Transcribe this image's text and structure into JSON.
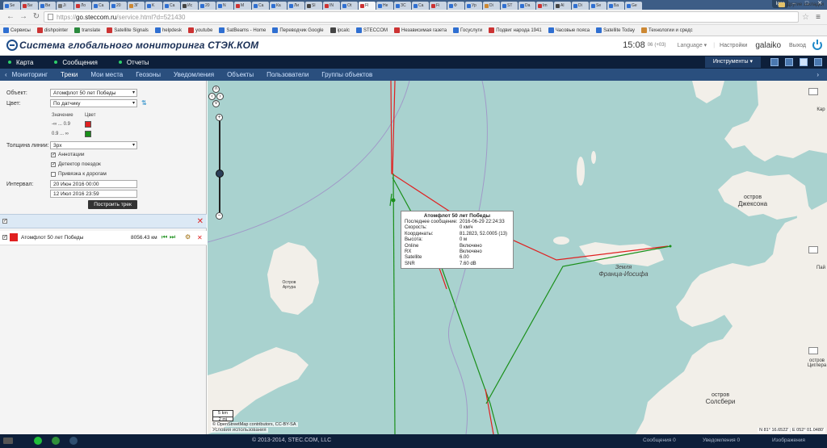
{
  "browser": {
    "user_badge": "Igor",
    "tabs": [
      {
        "label": "Se",
        "color": "#2f6fd1"
      },
      {
        "label": "Би",
        "color": "#cc3333"
      },
      {
        "label": "Ви",
        "color": "#2f6fd1"
      },
      {
        "label": "Ji",
        "color": "#777777"
      },
      {
        "label": "Ло",
        "color": "#cc3333"
      },
      {
        "label": "Ca",
        "color": "#2f6fd1"
      },
      {
        "label": "20",
        "color": "#2f6fd1"
      },
      {
        "label": "ЗГ",
        "color": "#cc8833"
      },
      {
        "label": "K",
        "color": "#2f6fd1"
      },
      {
        "label": "Ca",
        "color": "#2f6fd1"
      },
      {
        "label": "Ис",
        "color": "#444444"
      },
      {
        "label": "20",
        "color": "#2f6fd1"
      },
      {
        "label": "N",
        "color": "#2f6fd1"
      },
      {
        "label": "M",
        "color": "#cc3333"
      },
      {
        "label": "Ca",
        "color": "#2f6fd1"
      },
      {
        "label": "Ка",
        "color": "#2f6fd1"
      },
      {
        "label": "Ли",
        "color": "#2f6fd1"
      },
      {
        "label": "Sl",
        "color": "#444444"
      },
      {
        "label": "IN",
        "color": "#cc3333"
      },
      {
        "label": "Ot",
        "color": "#2f6fd1"
      },
      {
        "label": "Fl",
        "color": "#cc3333"
      },
      {
        "label": "Не",
        "color": "#2f6fd1"
      },
      {
        "label": "ЗС",
        "color": "#2f6fd1"
      },
      {
        "label": "Ca",
        "color": "#2f6fd1"
      },
      {
        "label": "Fi",
        "color": "#cc3333"
      },
      {
        "label": "Ф",
        "color": "#2f6fd1"
      },
      {
        "label": "Ур",
        "color": "#2f6fd1"
      },
      {
        "label": "Di",
        "color": "#cc8833"
      },
      {
        "label": "ST",
        "color": "#2f6fd1"
      },
      {
        "label": "Da",
        "color": "#2f6fd1"
      },
      {
        "label": "Im",
        "color": "#cc3333"
      },
      {
        "label": "Al",
        "color": "#444444"
      },
      {
        "label": "Di",
        "color": "#2f6fd1"
      },
      {
        "label": "Se",
        "color": "#2f6fd1"
      },
      {
        "label": "Ба",
        "color": "#2f6fd1"
      },
      {
        "label": "Ge",
        "color": "#2f6fd1"
      }
    ],
    "url_prefix": "https://",
    "url_host": "go.steccom.ru",
    "url_path": "/service.html?d=521430",
    "bookmarks": [
      {
        "label": "Сервисы",
        "color": "#2f6fd1"
      },
      {
        "label": "dishpointer",
        "color": "#cc3333"
      },
      {
        "label": "translate",
        "color": "#2b8a3e"
      },
      {
        "label": "Satellite Signals",
        "color": "#cc3333"
      },
      {
        "label": "helpdesk",
        "color": "#2f6fd1"
      },
      {
        "label": "youtube",
        "color": "#cc3333"
      },
      {
        "label": "SatBeams - Home",
        "color": "#2f6fd1"
      },
      {
        "label": "Переводчик Google",
        "color": "#2f6fd1"
      },
      {
        "label": "ipcalc",
        "color": "#444444"
      },
      {
        "label": "STECCOM",
        "color": "#2f6fd1"
      },
      {
        "label": "Независимая газета",
        "color": "#cc3333"
      },
      {
        "label": "Госуслуги",
        "color": "#2f6fd1"
      },
      {
        "label": "Подвиг народа 1941",
        "color": "#cc3333"
      },
      {
        "label": "Часовые пояса",
        "color": "#2f6fd1"
      },
      {
        "label": "Satellite Today",
        "color": "#2f6fd1"
      },
      {
        "label": "Технологии и средс",
        "color": "#cc8833"
      }
    ],
    "other_bookmarks": "Другие закладки"
  },
  "header": {
    "logo_text": "Система глобального мониторинга СТЭК.КОМ",
    "time": "15:08",
    "seconds": "06",
    "tz": "(+03)",
    "language": "Language",
    "settings": "Настройки",
    "username": "galaiko",
    "logout": "Выход"
  },
  "mainnav": {
    "items": [
      "Карта",
      "Сообщения",
      "Отчеты"
    ],
    "tools": "Инструменты"
  },
  "subnav": {
    "items": [
      "Мониторинг",
      "Треки",
      "Мои места",
      "Геозоны",
      "Уведомления",
      "Объекты",
      "Пользователи",
      "Группы объектов"
    ],
    "active": "Треки"
  },
  "form": {
    "object_label": "Объект:",
    "object_value": "Атомфлот 50 лет Победы",
    "color_label": "Цвет:",
    "color_value": "По датчику",
    "value_header": "Значение",
    "color_header": "Цвет",
    "range1": "-∞  ...  0.9",
    "range2": "0.9  ...  ∞",
    "range1_color": "#e02020",
    "range2_color": "#1a8f1a",
    "thickness_label": "Толщина линии:",
    "thickness_value": "3px",
    "annotations": "Аннотации",
    "trip_detector": "Детектор поездок",
    "snap_roads": "Привязка к дорогам",
    "interval_label": "Интервал:",
    "date_from": "20 Июн 2016 00:00",
    "date_to": "12 Июл 2016 23:59",
    "build_button": "Построить трек"
  },
  "track_list": {
    "items": [
      {
        "name": "Атомфлот 50 лет Победы",
        "distance": "8056.43 км",
        "color": "#e02020"
      }
    ]
  },
  "popup": {
    "title": "Атомфлот 50 лет Победы",
    "rows": [
      {
        "k": "Последнее сообщение:",
        "v": "2016-06-29 22:24:33"
      },
      {
        "k": "Скорость:",
        "v": "0 км/ч"
      },
      {
        "k": "Координаты:",
        "v": "81.2823, 52.0005 (13)"
      },
      {
        "k": "Высота:",
        "v": "0 м"
      },
      {
        "k": "Online",
        "v": "Включено"
      },
      {
        "k": "RX",
        "v": "Включено"
      },
      {
        "k": "Satellite",
        "v": "6.00"
      },
      {
        "k": "SNR",
        "v": "7.60 dB"
      }
    ]
  },
  "map": {
    "places": {
      "jackson_1": "остров",
      "jackson_2": "Джексона",
      "fji_1": "Земля",
      "fji_2": "Франца-Иосифа",
      "arthur_1": "Остров",
      "arthur_2": "Артура",
      "salisbury_1": "остров",
      "salisbury_2": "Солсбери",
      "karl": "Кар",
      "pay": "Пай",
      "zieg_1": "остров",
      "zieg_2": "Циглера"
    },
    "scale_km": "5 km",
    "scale_mi": "2 mi",
    "attribution": "© OpenStreetMap contributors, CC-BY-SA",
    "terms": "Условия использования",
    "coord_readout": "N 81° 16.6522' ; E 052° 01.0480'"
  },
  "footer": {
    "copyright": "© 2013-2014, STEC.COM, LLC",
    "messages_label": "Сообщения",
    "messages_count": "0",
    "notifications_label": "Уведомления",
    "notifications_count": "0",
    "images_label": "Изображения"
  }
}
